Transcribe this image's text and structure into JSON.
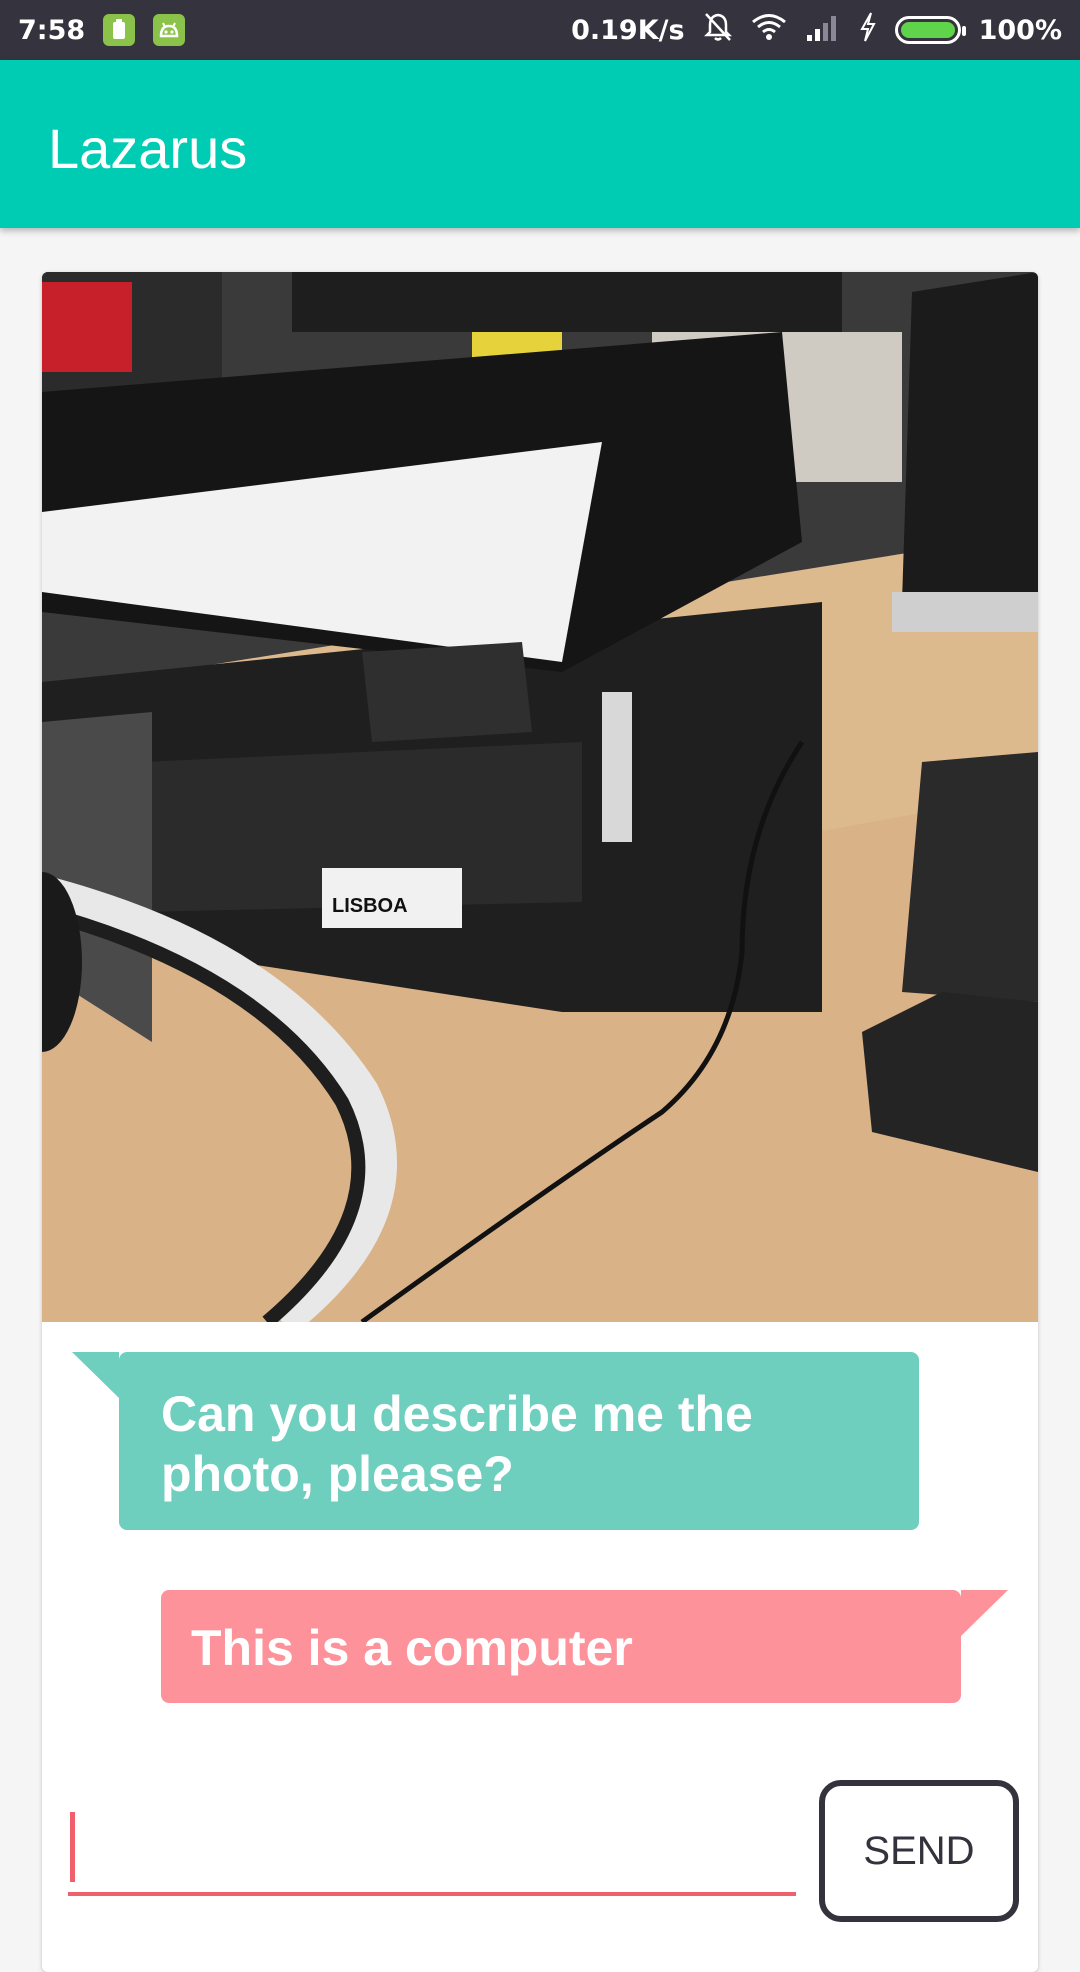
{
  "status_bar": {
    "time": "7:58",
    "network_speed": "0.19K/s",
    "battery_percent": "100%",
    "battery_level": 1.0,
    "icons": [
      "battery-saver-icon",
      "android-icon",
      "mute-notification-icon",
      "wifi-icon",
      "signal-icon",
      "charging-icon",
      "battery-icon"
    ]
  },
  "app_bar": {
    "title": "Lazarus",
    "color": "#00cbb3"
  },
  "chat": {
    "question": "Can you describe me the photo, please?",
    "answer": "This is a computer",
    "question_color": "#6fcfbf",
    "answer_color": "#fe929a"
  },
  "composer": {
    "input_value": "",
    "input_placeholder": "",
    "send_label": "SEND",
    "accent": "#ef5f6c"
  },
  "photo": {
    "label_text": "LISBOA"
  }
}
